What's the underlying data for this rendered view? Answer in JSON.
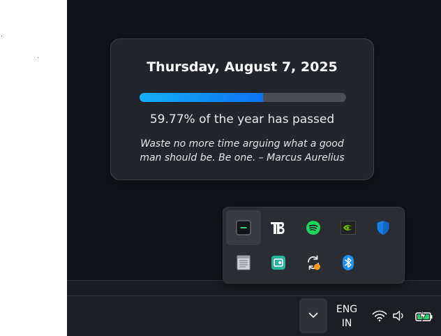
{
  "popup": {
    "date": "Thursday, August 7, 2025",
    "progress_fraction": 0.5977,
    "progress_text": "59.77% of the year has passed",
    "quote_line1": "Waste no more time arguing what a good",
    "quote_line2": "man should be. Be one. – Marcus Aurelius"
  },
  "tray_icons": [
    {
      "name": "terminal-icon",
      "selected": true
    },
    {
      "name": "tb-icon"
    },
    {
      "name": "spotify-icon"
    },
    {
      "name": "nvidia-icon"
    },
    {
      "name": "shield-icon"
    },
    {
      "name": "notepad-icon"
    },
    {
      "name": "camera-app-icon"
    },
    {
      "name": "sync-icon"
    },
    {
      "name": "bluetooth-icon"
    }
  ],
  "taskbar": {
    "lang_line1": "ENG",
    "lang_line2": "IN"
  },
  "colors": {
    "accent": "#0a74f0",
    "spotify": "#1ed760",
    "nvidia": "#76b900",
    "shield": "#1a7de6",
    "bluetooth": "#1c8ef5",
    "sync_badge": "#f79a1e",
    "camera_app": "#2bb39a"
  }
}
